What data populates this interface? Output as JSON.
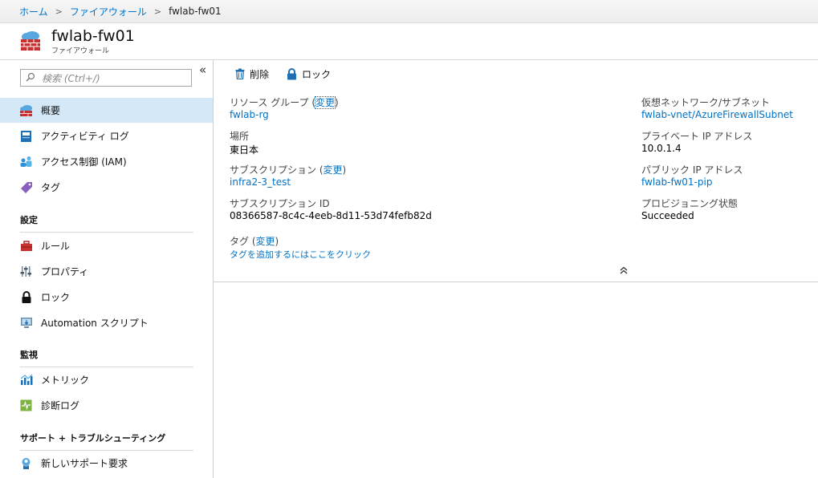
{
  "breadcrumb": {
    "home": "ホーム",
    "firewalls": "ファイアウォール",
    "current": "fwlab-fw01"
  },
  "header": {
    "title": "fwlab-fw01",
    "subtitle": "ファイアウォール"
  },
  "sidebar": {
    "search_placeholder": "検索 (Ctrl+/)",
    "items": [
      {
        "label": "概要",
        "icon": "overview-icon"
      },
      {
        "label": "アクティビティ ログ",
        "icon": "activity-log-icon"
      },
      {
        "label": "アクセス制御 (IAM)",
        "icon": "iam-icon"
      },
      {
        "label": "タグ",
        "icon": "tag-icon"
      }
    ],
    "settings_header": "設定",
    "settings_items": [
      {
        "label": "ルール",
        "icon": "toolbox-icon"
      },
      {
        "label": "プロパティ",
        "icon": "properties-icon"
      },
      {
        "label": "ロック",
        "icon": "lock-icon"
      },
      {
        "label": "Automation スクリプト",
        "icon": "automation-icon"
      }
    ],
    "monitoring_header": "監視",
    "monitoring_items": [
      {
        "label": "メトリック",
        "icon": "metrics-icon"
      },
      {
        "label": "診断ログ",
        "icon": "diagnostics-icon"
      }
    ],
    "support_header": "サポート + トラブルシューティング",
    "support_items": [
      {
        "label": "新しいサポート要求",
        "icon": "support-icon"
      }
    ]
  },
  "toolbar": {
    "delete_label": "削除",
    "lock_label": "ロック"
  },
  "essentials": {
    "resource_group_label": "リソース グループ",
    "change_label": "変更",
    "resource_group_value": "fwlab-rg",
    "location_label": "場所",
    "location_value": "東日本",
    "subscription_label": "サブスクリプション",
    "subscription_value": "infra2-3_test",
    "subscription_id_label": "サブスクリプション ID",
    "subscription_id_value": "08366587-8c4c-4eeb-8d11-53d74fefb82d",
    "tags_label": "タグ",
    "tags_add": "タグを追加するにはここをクリック",
    "vnet_label": "仮想ネットワーク/サブネット",
    "vnet_value": "fwlab-vnet/AzureFirewallSubnet",
    "private_ip_label": "プライベート IP アドレス",
    "private_ip_value": "10.0.1.4",
    "public_ip_label": "パブリック IP アドレス",
    "public_ip_value": "fwlab-fw01-pip",
    "provisioning_label": "プロビジョニング状態",
    "provisioning_value": "Succeeded"
  },
  "colors": {
    "link": "#0072c6",
    "active_nav": "#d5e8f8",
    "firewall_red": "#c8312f"
  }
}
